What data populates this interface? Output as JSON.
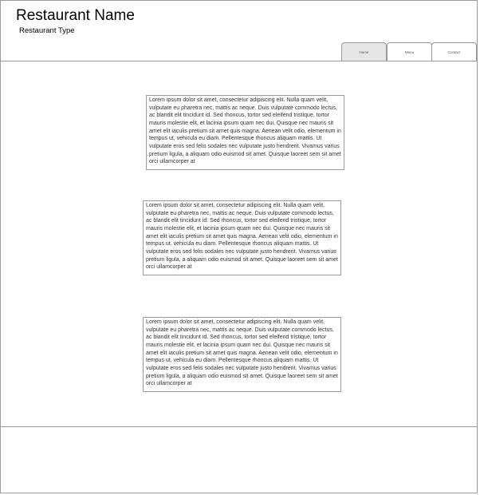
{
  "header": {
    "title": "Restaurant Name",
    "subtitle": "Restaurant Type"
  },
  "nav": {
    "tabs": [
      {
        "label": "Home",
        "active": true
      },
      {
        "label": "Menu",
        "active": false
      },
      {
        "label": "Contact",
        "active": false
      }
    ]
  },
  "content": {
    "blocks": [
      {
        "text": "Lorem ipsum dolor sit amet, consectetur adipiscing elit. Nulla quam velit, vulputate eu pharetra nec, mattis ac neque. Duis vulputate commodo lectus, ac blandit elit tincidunt id. Sed rhoncus, tortor sed eleifend tristique, tortor mauris molestie elit, et lacinia ipsum quam nec dui. Quisque nec mauris sit amet elit iaculis pretium sit amet quis magna. Aenean velit odio, elementum in tempus ut, vehicula eu diam. Pellentesque rhoncus aliquam mattis. Ut vulputate eros sed felis sodales nec vulputate justo hendrerit. Vivamus varius pretium ligula, a aliquam odio euismod sit amet. Quisque laoreet sem sit amet orci ullamcorper at"
      },
      {
        "text": "Lorem ipsum dolor sit amet, consectetur adipiscing elit. Nulla quam velit, vulputate eu pharetra nec, mattis ac neque. Duis vulputate commodo lectus, ac blandit elit tincidunt id. Sed rhoncus, tortor sed eleifend tristique, tortor mauris molestie elit, et lacinia ipsum quam nec dui. Quisque nec mauris sit amet elit iaculis pretium sit amet quis magna. Aenean velit odio, elementum in tempus ut, vehicula eu diam. Pellentesque rhoncus aliquam mattis. Ut vulputate eros sed felis sodales nec vulputate justo hendrerit. Vivamus varius pretium ligula, a aliquam odio euismod sit amet. Quisque laoreet sem sit amet orci ullamcorper at"
      },
      {
        "text": "Lorem ipsum dolor sit amet, consectetur adipiscing elit. Nulla quam velit, vulputate eu pharetra nec, mattis ac neque. Duis vulputate commodo lectus, ac blandit elit tincidunt id. Sed rhoncus, tortor sed eleifend tristique, tortor mauris molestie elit, et lacinia ipsum quam nec dui. Quisque nec mauris sit amet elit iaculis pretium sit amet quis magna. Aenean velit odio, elementum in tempus ut, vehicula eu diam. Pellentesque rhoncus aliquam mattis. Ut vulputate eros sed felis sodales nec vulputate justo hendrerit. Vivamus varius pretium ligula, a aliquam odio euismod sit amet. Quisque laoreet sem sit amet orci ullamcorper at"
      }
    ]
  },
  "colors": {
    "border": "#9a9a9a",
    "active_tab": "#e6e6e6"
  }
}
